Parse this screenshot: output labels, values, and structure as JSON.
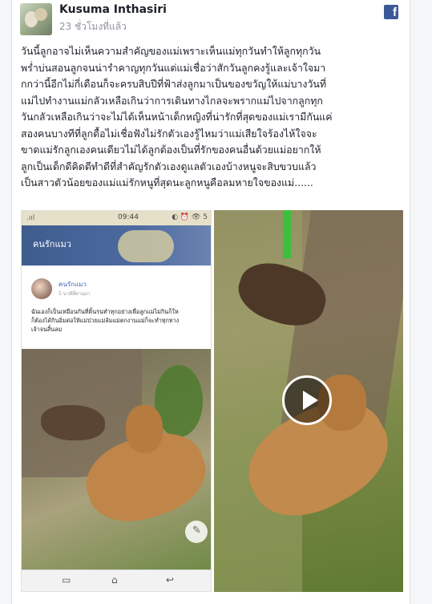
{
  "post": {
    "author": "Kusuma Inthasiri",
    "timestamp": "23 ชั่วโมงที่แล้ว",
    "platform_icon": "facebook-icon",
    "text_lines": [
      "วันนี้ลูกอาจไม่เห็นความสำคัญของแม่เพราะเห็นแม่ทุกวันทำให้ลูกทุกวัน",
      "พร่ำบ่นสอนลูกจนน่ารำคาญทุกวันแต่แม่เชื่อว่าสักวันลูกคงรู้และเจ้าใจมา",
      "กกว่านี้อีกไม่กี่เดือนก็จะครบสิบปีที่ฟ้าส่งลูกมาเป็นของขวัญให้แม่บางวันที่",
      "แม่ไปทำงานแม่กลัวเหลือเกินว่าการเดินทางไกลจะพรากแม่ไปจากลูกทุก",
      "วันกลัวเหลือเกินว่าจะไม่ได้เห็นหน้าเด็กหญิงที่น่ารักที่สุดของแม่เรามีกันแค่",
      "สองคนบางทีที่ลูกดื้อไม่เชื่อฟังไม่รักตัวเองรู้ไหมว่าแม่เสียใจร้องไห้ใจจะ",
      "ขาดแม่รักลูกเองคนเดียวไม่ได้ลูกต้องเป็นที่รักของคนอื่นด้วยแม่อยากให้",
      "ลูกเป็นเด็กดีคิดดีทำดีที่สำคัญรักตัวเองดูแลตัวเองบ้างหนูจะสิบขวบแล้ว",
      "เป็นสาวตัวน้อยของแม่แม่รักหนูที่สุดนะลูกหนูคือลมหายใจของแม่......"
    ]
  },
  "screenshot": {
    "status_signal": ".ııl",
    "clock": "09:44",
    "status_icons": "◐ ⏰ 👁 5",
    "app_title": "คนรักแมว",
    "inner_author": "คนรักแมว",
    "inner_time": "5 นาทีที่ผ่านมา",
    "inner_text_lines": [
      "ฉันเองก็เป็นเหมือนกันที่ดิ้นรนทำทุกอย่างเพื่อลูกแม่ไม่กินก็ให",
      "ก็ต้องได้กินอิ่มต่อให้แม่ป่วยแม่ล้มแม่ตกงานแม่ก็จะทำทุกทาง",
      "เจ้าจนสิ้นลม"
    ],
    "nav_left": "▭",
    "nav_center": "⌂",
    "nav_right": "↩"
  },
  "video": {
    "play_icon": "play-icon"
  },
  "colors": {
    "facebook_blue": "#3b5998",
    "author_text": "#1d2129",
    "timestamp_text": "#90949c"
  }
}
